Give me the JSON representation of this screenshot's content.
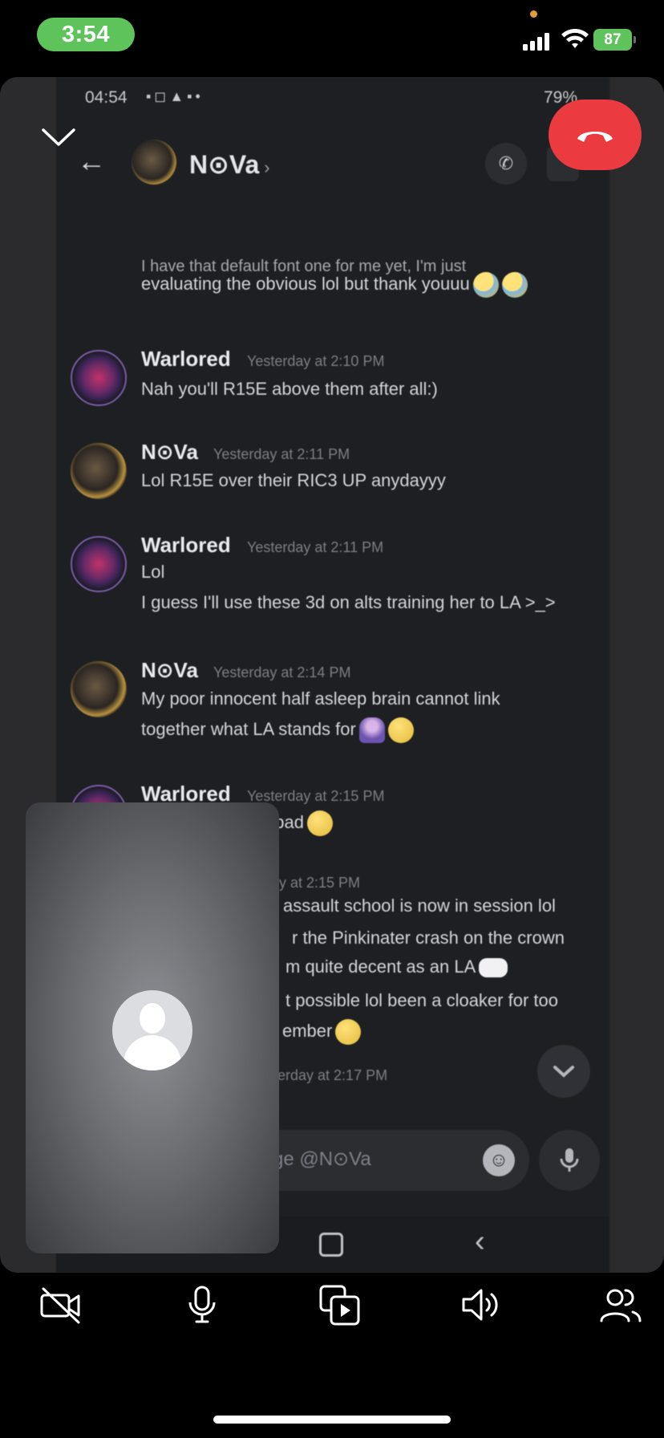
{
  "status_bar": {
    "time": "3:54",
    "battery": "87"
  },
  "shared_screen": {
    "android_status": {
      "time": "04:54",
      "icons": "▪◻▲▪•",
      "battery": "79%"
    },
    "header": {
      "contact_name": "N⊙Va",
      "chevron": "›"
    },
    "messages": [
      {
        "partial_top": "evaluating the obvious lol but thank youuu",
        "cut_line": "I have that default font one for me yet, I'm just"
      },
      {
        "author": "Warlored",
        "time": "Yesterday at 2:10 PM",
        "lines": [
          "Nah you'll R15E above them after all:)"
        ]
      },
      {
        "author": "N⊙Va",
        "time": "Yesterday at 2:11 PM",
        "lines": [
          "Lol R15E over their RIC3 UP anydayyy"
        ]
      },
      {
        "author": "Warlored",
        "time": "Yesterday at 2:11 PM",
        "lines": [
          "Lol",
          "I guess I'll use these 3d on alts training her to LA >_>"
        ]
      },
      {
        "author": "N⊙Va",
        "time": "Yesterday at 2:14 PM",
        "lines": [
          "My poor innocent half asleep brain cannot link",
          "together what LA stands for"
        ]
      },
      {
        "author": "Warlored",
        "time": "Yesterday at 2:15 PM",
        "lines": [
          "Light Assault my bad"
        ]
      },
      {
        "time": "y at 2:15 PM",
        "lines": [
          "assault school is now in session lol",
          "r the Pinkinater crash on the crown",
          "m quite decent as an LA",
          "t possible lol been a cloaker for too",
          "ember"
        ]
      },
      {
        "time": "erday at 2:17 PM"
      }
    ],
    "composer": {
      "placeholder": "ge @N⊙Va"
    }
  },
  "icons": {
    "scroll_down": "chevron-down-icon",
    "back": "back-arrow-icon",
    "call": "phone-icon",
    "emoji": "emoji-icon",
    "mic": "mic-icon",
    "end_call": "end-call-icon",
    "collapse": "chevron-down-icon"
  },
  "colors": {
    "status_pill": "#5fc35c",
    "end_call": "#eb3a40",
    "discord_bg": "#1e1f22"
  }
}
